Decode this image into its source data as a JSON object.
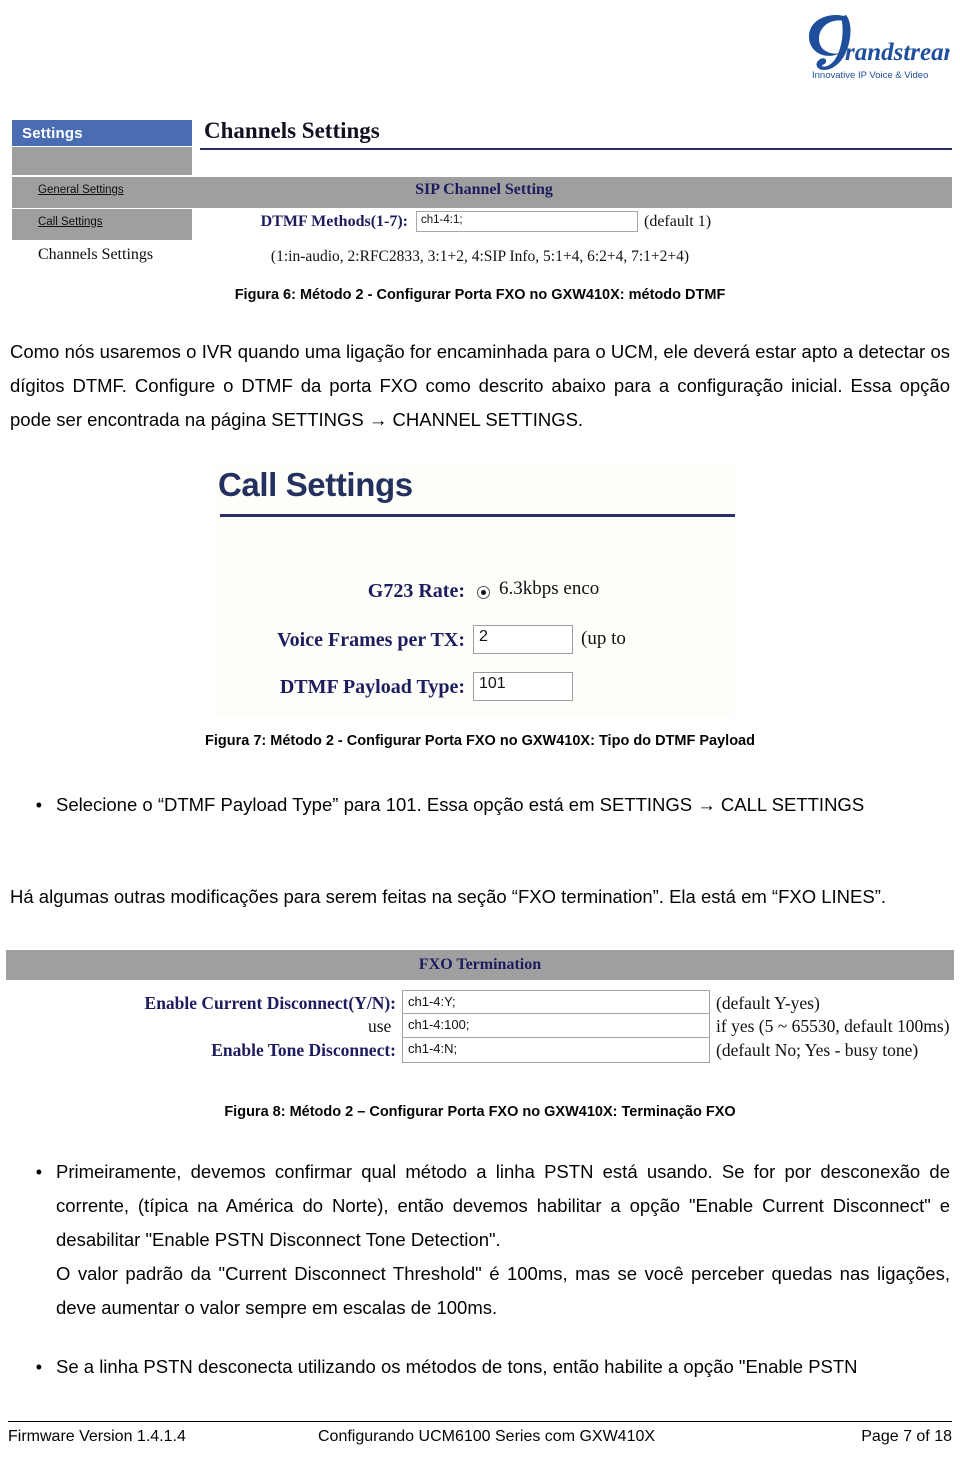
{
  "logo": {
    "wordmark": "randstream",
    "tagline": "Innovative IP Voice & Video",
    "brand_color": "#1f4e9c"
  },
  "figure6": {
    "tab_label": "Settings",
    "page_title": "Channels Settings",
    "nav_items": [
      {
        "label": "General Settings",
        "style": "link"
      },
      {
        "label": "Call Settings",
        "style": "link"
      },
      {
        "label": "Channels Settings",
        "style": "plain"
      }
    ],
    "section_header": "SIP Channel Setting",
    "field_label": "DTMF Methods(1-7):",
    "field_value": "ch1-4:1;",
    "field_hint": "(default 1)",
    "legend": "(1:in-audio, 2:RFC2833, 3:1+2, 4:SIP Info, 5:1+4, 6:2+4, 7:1+2+4)"
  },
  "caption6": "Figura 6: Método 2 - Configurar Porta FXO no GXW410X: método DTMF",
  "paragraph1": "Como nós usaremos o IVR quando uma ligação for encaminhada para o UCM, ele deverá estar apto a detectar os dígitos DTMF. Configure o DTMF da porta FXO como descrito abaixo para a configuração inicial. Essa opção pode ser encontrada na página SETTINGS → CHANNEL SETTINGS.",
  "figure7": {
    "title": "Call Settings",
    "rows": [
      {
        "label": "G723 Rate:",
        "control": "radio",
        "value": "6.3kbps enco",
        "hint": ""
      },
      {
        "label": "Voice Frames per TX:",
        "control": "input",
        "value": "2",
        "hint": "(up to"
      },
      {
        "label": "DTMF Payload Type:",
        "control": "input",
        "value": "101",
        "hint": ""
      }
    ]
  },
  "caption7": "Figura 7: Método 2 - Configurar Porta FXO no GXW410X: Tipo do DTMF Payload",
  "bullet1": "Selecione o “DTMF Payload Type” para 101. Essa opção está em SETTINGS → CALL SETTINGS",
  "bullet1_dot": "•",
  "paragraph2": "Há algumas outras modificações para serem feitas na seção “FXO termination”. Ela está em “FXO LINES”.",
  "figure8": {
    "band_title": "FXO Termination",
    "rows": [
      {
        "label": "Enable Current Disconnect(Y/N):",
        "prefix": "",
        "value": "ch1-4:Y;",
        "hint": "(default Y-yes)"
      },
      {
        "label": "",
        "prefix": "use",
        "value": "ch1-4:100;",
        "hint": "if yes (5 ~ 65530, default 100ms)"
      },
      {
        "label": "Enable Tone Disconnect:",
        "prefix": "",
        "value": "ch1-4:N;",
        "hint": "(default No; Yes - busy tone)"
      }
    ]
  },
  "caption8": "Figura 8: Método 2 – Configurar Porta FXO no GXW410X: Terminação FXO",
  "bullet2_dot": "•",
  "bullet2": "Primeiramente, devemos confirmar qual método a linha PSTN está usando. Se for por desconexão de corrente, (típica na América do Norte), então devemos habilitar a opção \"Enable Current Disconnect\" e desabilitar \"Enable PSTN Disconnect Tone Detection\".",
  "paragraph3": "O valor padrão da \"Current Disconnect Threshold\" é 100ms, mas se você perceber quedas nas ligações, deve aumentar o valor sempre em escalas de 100ms.",
  "bullet3_dot": "•",
  "bullet3": "Se a linha PSTN desconecta utilizando os métodos de tons, então habilite a opção \"Enable PSTN",
  "footer": {
    "left": "Firmware Version 1.4.1.4",
    "center": "Configurando UCM6100 Series com GXW410X",
    "right": "Page 7 of 18"
  }
}
